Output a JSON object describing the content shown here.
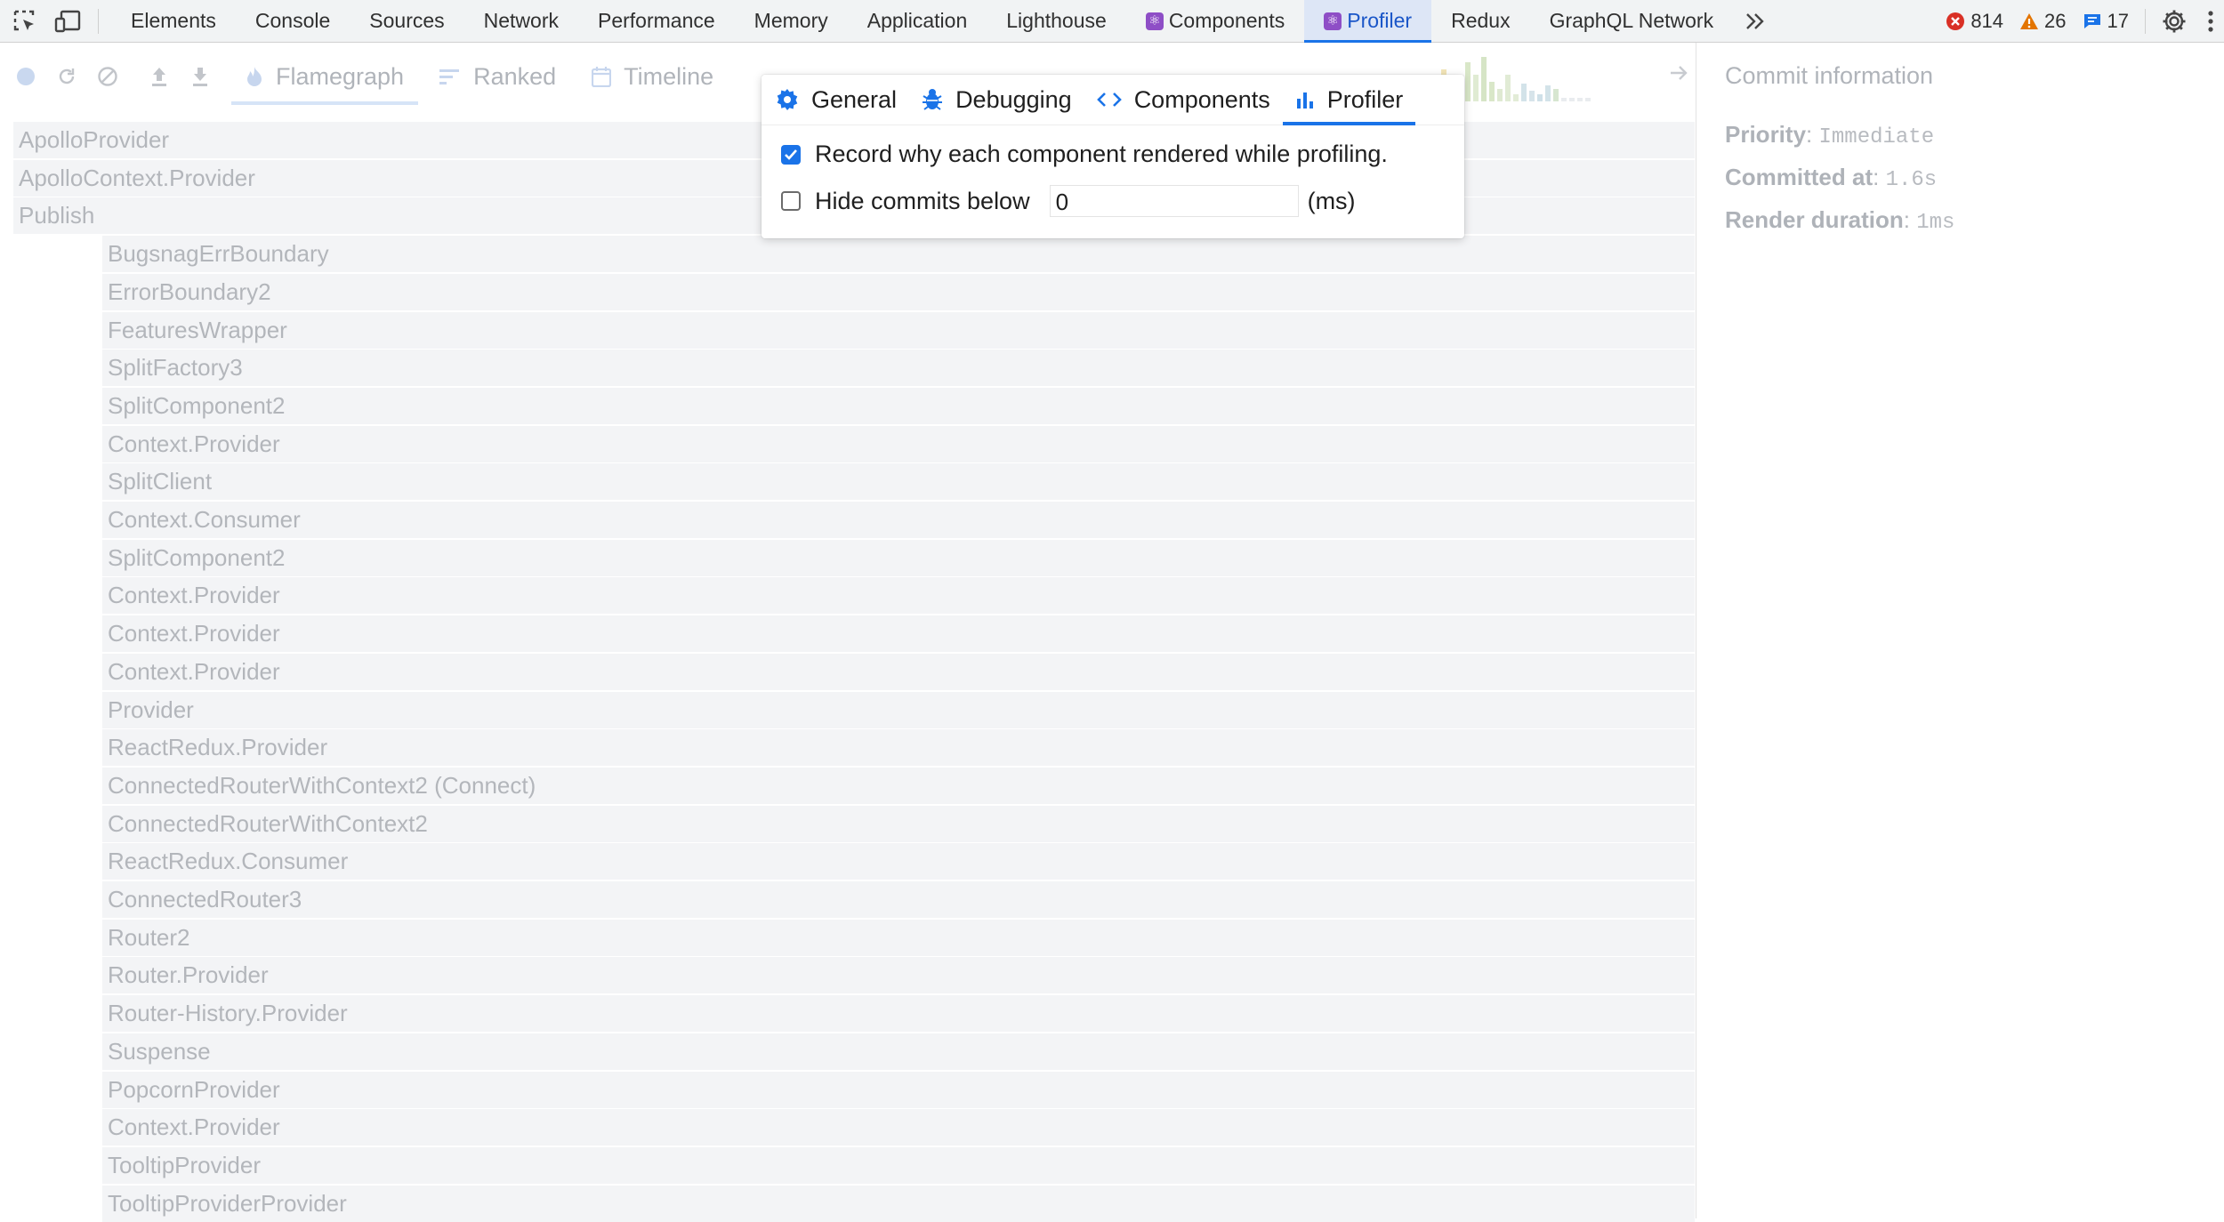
{
  "top_tabs": [
    "Elements",
    "Console",
    "Sources",
    "Network",
    "Performance",
    "Memory",
    "Application",
    "Lighthouse",
    "Components",
    "Profiler",
    "Redux",
    "GraphQL Network"
  ],
  "active_top_tab": "Profiler",
  "counters": {
    "errors": "814",
    "warnings": "26",
    "messages": "17"
  },
  "colors": {
    "accent": "#1a73e8",
    "error": "#d93025",
    "warning": "#e37400",
    "react": "#8e4ec6"
  },
  "profiler": {
    "tabs": [
      "Flamegraph",
      "Ranked",
      "Timeline"
    ],
    "active_tab": "Flamegraph"
  },
  "flamegraph": {
    "root_rows": [
      "ApolloProvider",
      "ApolloContext.Provider",
      "Publish"
    ],
    "child_rows": [
      "BugsnagErrBoundary",
      "ErrorBoundary2",
      "FeaturesWrapper",
      "SplitFactory3",
      "SplitComponent2",
      "Context.Provider",
      "SplitClient",
      "Context.Consumer",
      "SplitComponent2",
      "Context.Provider",
      "Context.Provider",
      "Context.Provider",
      "Provider",
      "ReactRedux.Provider",
      "ConnectedRouterWithContext2 (Connect)",
      "ConnectedRouterWithContext2",
      "ReactRedux.Consumer",
      "ConnectedRouter3",
      "Router2",
      "Router.Provider",
      "Router-History.Provider",
      "Suspense",
      "PopcornProvider",
      "Context.Provider",
      "TooltipProvider",
      "TooltipProviderProvider"
    ]
  },
  "commit_info": {
    "title": "Commit information",
    "priority_label": "Priority",
    "priority_value": "Immediate",
    "committed_label": "Committed at",
    "committed_value": "1.6s",
    "duration_label": "Render duration",
    "duration_value": "1ms"
  },
  "settings_popup": {
    "tabs": [
      "General",
      "Debugging",
      "Components",
      "Profiler"
    ],
    "active_tab": "Profiler",
    "record_why_label": "Record why each component rendered while profiling.",
    "record_why_checked": true,
    "hide_commits_label": "Hide commits below",
    "hide_commits_checked": false,
    "hide_commits_value": "0",
    "hide_commits_unit": "(ms)"
  }
}
